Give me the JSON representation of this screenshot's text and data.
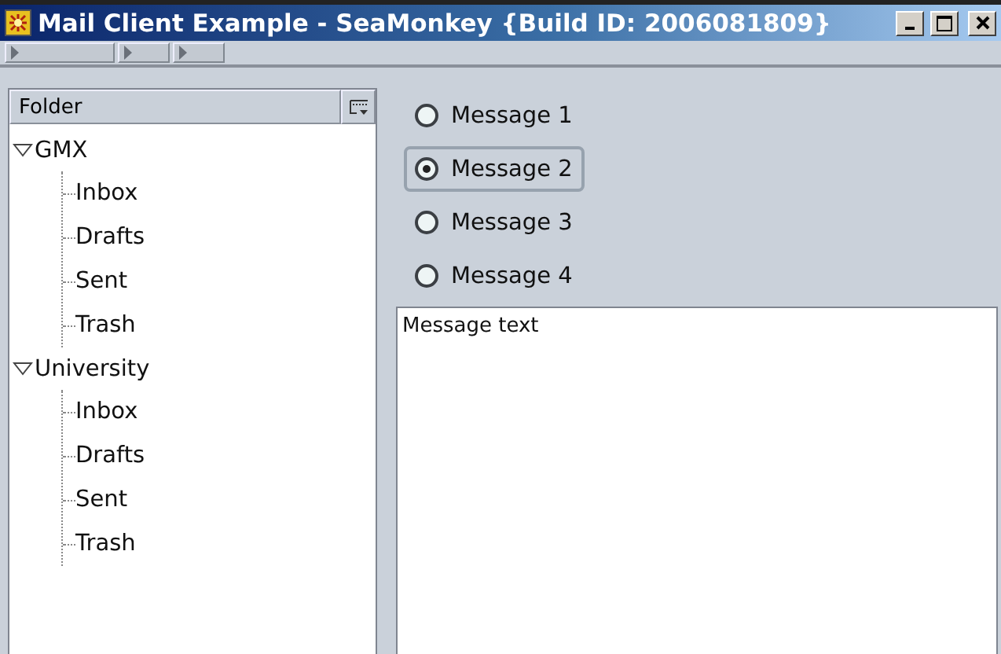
{
  "window": {
    "title": "Mail Client Example - SeaMonkey {Build ID: 2006081809}"
  },
  "toolbars": [
    {
      "kind": "grippy"
    },
    {
      "kind": "grippy"
    },
    {
      "kind": "grippy"
    }
  ],
  "folder_tree": {
    "header": "Folder",
    "items": [
      {
        "label": "GMX",
        "expanded": true,
        "children": [
          {
            "label": "Inbox"
          },
          {
            "label": "Drafts"
          },
          {
            "label": "Sent"
          },
          {
            "label": "Trash"
          }
        ]
      },
      {
        "label": "University",
        "expanded": true,
        "children": [
          {
            "label": "Inbox"
          },
          {
            "label": "Drafts"
          },
          {
            "label": "Sent"
          },
          {
            "label": "Trash"
          }
        ]
      }
    ]
  },
  "messages": [
    {
      "label": "Message 1",
      "selected": false
    },
    {
      "label": "Message 2",
      "selected": true
    },
    {
      "label": "Message 3",
      "selected": false
    },
    {
      "label": "Message 4",
      "selected": false
    }
  ],
  "message_text": {
    "value": "Message text"
  }
}
